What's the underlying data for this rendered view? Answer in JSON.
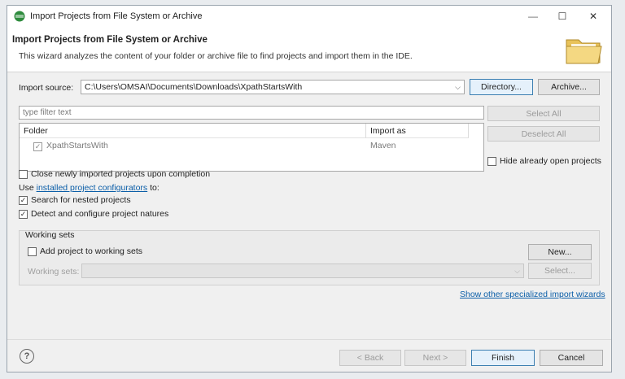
{
  "window": {
    "title": "Import Projects from File System or Archive",
    "controls": {
      "minimize": "—",
      "maximize": "☐",
      "close": "✕"
    }
  },
  "banner": {
    "title": "Import Projects from File System or Archive",
    "description": "This wizard analyzes the content of your folder or archive file to find projects and import them in the IDE."
  },
  "source": {
    "label": "Import source:",
    "value": "C:\\Users\\OMSAI\\Documents\\Downloads\\XpathStartsWith",
    "directory_button": "Directory...",
    "archive_button": "Archive..."
  },
  "filter": {
    "placeholder": "type filter text"
  },
  "table": {
    "headers": [
      "Folder",
      "Import as"
    ],
    "rows": [
      {
        "folder": "XpathStartsWith",
        "import_as": "Maven",
        "checked": true
      }
    ]
  },
  "side_buttons": {
    "select_all": "Select All",
    "deselect_all": "Deselect All",
    "hide_open": "Hide already open projects"
  },
  "options": {
    "close_imported": "Close newly imported projects upon completion",
    "use_prefix": "Use",
    "configurators_link": "installed project configurators",
    "use_suffix": "to:",
    "search_nested": "Search for nested projects",
    "detect_natures": "Detect and configure project natures"
  },
  "working_sets": {
    "title": "Working sets",
    "add_label": "Add project to working sets",
    "new_button": "New...",
    "sets_label": "Working sets:",
    "select_button": "Select..."
  },
  "wizards_link": "Show other specialized import wizards",
  "footer": {
    "help": "?",
    "back": "< Back",
    "next": "Next >",
    "finish": "Finish",
    "cancel": "Cancel"
  },
  "colors": {
    "link": "#0b5ea8",
    "accent": "#3c7fb1"
  },
  "icons": [
    "eclipse-app-icon",
    "folder-icon",
    "checkbox-check-icon",
    "dropdown-arrow-icon",
    "help-icon"
  ]
}
